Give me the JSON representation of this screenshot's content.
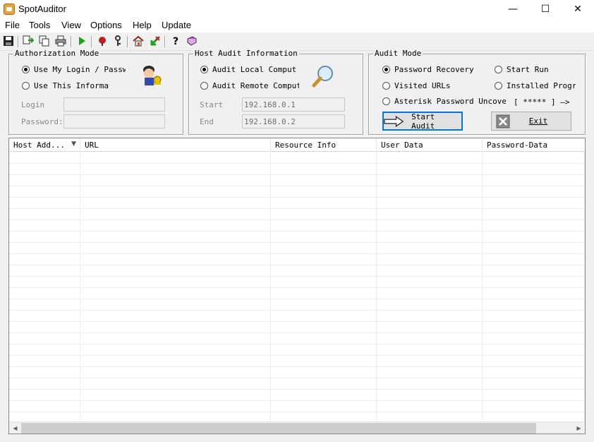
{
  "window": {
    "title": "SpotAuditor",
    "minimize": "—",
    "maximize": "☐",
    "close": "✕"
  },
  "menu": [
    "File",
    "Tools",
    "View",
    "Options",
    "Help",
    "Update"
  ],
  "toolbar": {
    "icons": [
      "save-icon",
      "copy-icon",
      "copy-all-icon",
      "print-icon",
      "run-icon",
      "stop-icon",
      "key-icon",
      "home-icon",
      "exit-icon",
      "help-icon",
      "book-icon"
    ]
  },
  "auth": {
    "title": "Authorization Mode",
    "option1": "Use My Login / Password",
    "option2": "Use This Information",
    "login_label": "Login",
    "password_label": "Password:",
    "login_value": "",
    "password_value": ""
  },
  "host": {
    "title": "Host Audit Information",
    "option1": "Audit Local Computer",
    "option2": "Audit Remote Computer",
    "start_label": "Start",
    "end_label": "End",
    "start_value": "192.168.0.1",
    "end_value": "192.168.0.2"
  },
  "audit": {
    "title": "Audit Mode",
    "opt_password_recovery": "Password Recovery",
    "opt_start_run": "Start Run",
    "opt_visited_urls": "Visited URLs",
    "opt_installed_programs": "Installed Programs",
    "opt_asterisk": "Asterisk Password Uncover",
    "asterisk_hint": "[ ***** ] —>",
    "start_button": "Start Audit",
    "exit_button": "Exit"
  },
  "table": {
    "columns": [
      "Host Add...",
      "URL",
      "Resource Info",
      "User Data",
      "Password-Data"
    ],
    "sort_indicator": "▼",
    "rows": []
  },
  "scrollbar": {
    "left": "◀",
    "right": "▶"
  }
}
